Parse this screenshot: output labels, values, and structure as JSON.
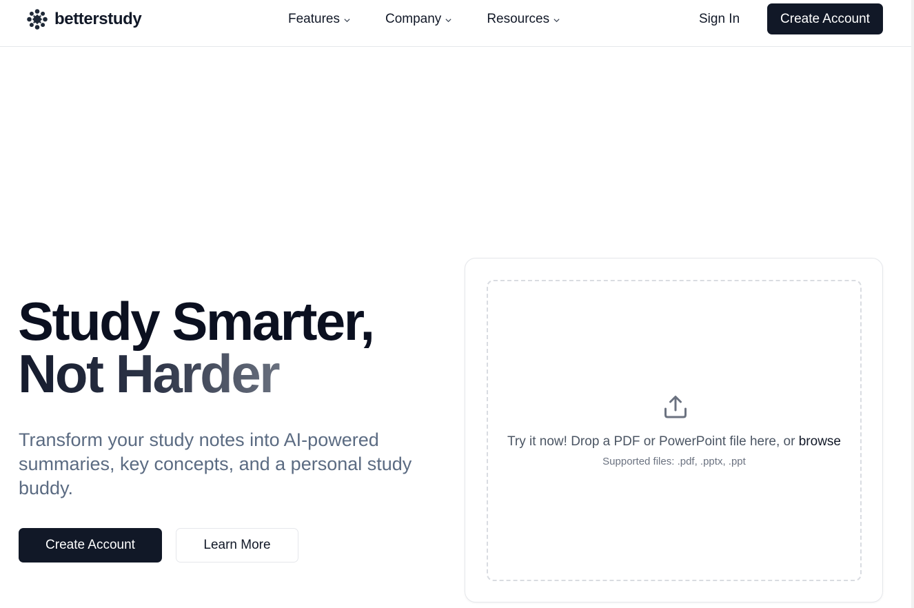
{
  "brand": {
    "name": "betterstudy"
  },
  "nav": {
    "items": [
      {
        "label": "Features"
      },
      {
        "label": "Company"
      },
      {
        "label": "Resources"
      }
    ],
    "sign_in": "Sign In",
    "create_account": "Create Account"
  },
  "hero": {
    "title_line1": "Study Smarter,",
    "title_line2": "Not Harder",
    "subtitle": "Transform your study notes into AI-powered summaries, key concepts, and a personal study buddy.",
    "primary_button": "Create Account",
    "secondary_button": "Learn More"
  },
  "upload": {
    "prompt": "Try it now! Drop a PDF or PowerPoint file here, or ",
    "browse_label": "browse",
    "supported": "Supported files: .pdf, .pptx, .ppt"
  },
  "colors": {
    "primary": "#111827",
    "muted_text": "#5b6b82",
    "border": "#e5e7eb"
  },
  "icons": {
    "logo": "dotted-circle-logo-icon",
    "dropdown": "chevron-down-icon",
    "upload": "upload-icon"
  }
}
